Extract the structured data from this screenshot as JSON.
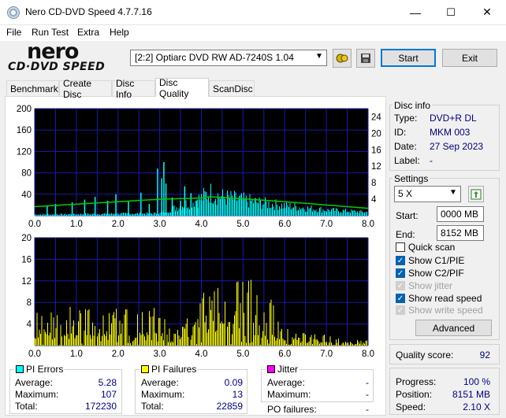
{
  "window": {
    "title": "Nero CD-DVD Speed 4.7.7.16",
    "minimize": "—",
    "maximize": "☐",
    "close": "✕"
  },
  "menu": [
    "File",
    "Run Test",
    "Extra",
    "Help"
  ],
  "logo": {
    "main": "nero",
    "sub": "CD·DVD SPEED"
  },
  "toolbar": {
    "drive": "[2:2]  Optiarc DVD RW AD-7240S 1.04",
    "start_label": "Start",
    "exit_label": "Exit"
  },
  "tabs": [
    "Benchmark",
    "Create Disc",
    "Disc Info",
    "Disc Quality",
    "ScanDisc"
  ],
  "active_tab": "Disc Quality",
  "disc_info": {
    "title": "Disc info",
    "type_label": "Type:",
    "type": "DVD+R DL",
    "id_label": "ID:",
    "id": "MKM 003",
    "date_label": "Date:",
    "date": "27 Sep 2023",
    "label_label": "Label:",
    "label": "-"
  },
  "settings": {
    "title": "Settings",
    "speed": "5 X",
    "start_label": "Start:",
    "start": "0000 MB",
    "end_label": "End:",
    "end": "8152 MB",
    "quick_scan": "Quick scan",
    "show_c1": "Show C1/PIE",
    "show_c2": "Show C2/PIF",
    "show_jitter": "Show jitter",
    "show_read": "Show read speed",
    "show_write": "Show write speed",
    "advanced": "Advanced"
  },
  "quality": {
    "label": "Quality score:",
    "value": "92"
  },
  "progress": {
    "progress_label": "Progress:",
    "progress": "100 %",
    "position_label": "Position:",
    "position": "8151 MB",
    "speed_label": "Speed:",
    "speed": "2.10 X"
  },
  "pi_errors": {
    "title": "PI Errors",
    "color": "#00ffff",
    "avg_label": "Average:",
    "avg": "5.28",
    "max_label": "Maximum:",
    "max": "107",
    "total_label": "Total:",
    "total": "172230"
  },
  "pi_failures": {
    "title": "PI Failures",
    "color": "#ffff00",
    "avg_label": "Average:",
    "avg": "0.09",
    "max_label": "Maximum:",
    "max": "13",
    "total_label": "Total:",
    "total": "22859"
  },
  "jitter": {
    "title": "Jitter",
    "color": "#ff00ff",
    "avg_label": "Average:",
    "avg": "-",
    "max_label": "Maximum:",
    "max": "-",
    "po_label": "PO failures:",
    "po": "-"
  },
  "chart_data": [
    {
      "type": "bar",
      "name": "PI Errors",
      "x_ticks": [
        "0.0",
        "1.0",
        "2.0",
        "3.0",
        "4.0",
        "5.0",
        "6.0",
        "7.0",
        "8.0"
      ],
      "y_ticks_left": [
        "200",
        "160",
        "120",
        "80",
        "40"
      ],
      "y_ticks_right": [
        "24",
        "20",
        "16",
        "12",
        "8",
        "4"
      ],
      "xlim": [
        0,
        8
      ],
      "ylim": [
        0,
        200
      ],
      "y2lim": [
        0,
        26
      ],
      "series_color": "#00ffff",
      "spikes": [
        [
          0.3,
          18
        ],
        [
          0.5,
          22
        ],
        [
          0.9,
          25
        ],
        [
          1.2,
          30
        ],
        [
          1.45,
          35
        ],
        [
          1.75,
          28
        ],
        [
          1.95,
          40
        ],
        [
          2.25,
          27
        ],
        [
          2.55,
          43
        ],
        [
          2.75,
          22
        ],
        [
          2.95,
          88
        ],
        [
          3.05,
          70
        ],
        [
          3.1,
          100
        ],
        [
          3.15,
          60
        ],
        [
          3.3,
          34
        ],
        [
          3.5,
          28
        ],
        [
          3.6,
          55
        ],
        [
          3.75,
          42
        ],
        [
          3.9,
          30
        ]
      ],
      "baseline": [
        [
          0,
          3
        ],
        [
          1,
          4
        ],
        [
          2,
          5
        ],
        [
          3,
          6
        ],
        [
          4,
          45
        ],
        [
          4.2,
          60
        ],
        [
          4.5,
          48
        ],
        [
          5,
          40
        ],
        [
          5.5,
          32
        ],
        [
          6,
          26
        ],
        [
          6.5,
          20
        ],
        [
          7,
          15
        ],
        [
          7.5,
          12
        ],
        [
          8,
          9
        ]
      ],
      "read_speed": [
        [
          0,
          2.2
        ],
        [
          1,
          2.8
        ],
        [
          2,
          3.4
        ],
        [
          3,
          4.0
        ],
        [
          4,
          4.3
        ],
        [
          4.2,
          4.6
        ],
        [
          5,
          4.1
        ],
        [
          6,
          3.4
        ],
        [
          7,
          2.6
        ],
        [
          8,
          1.8
        ]
      ]
    },
    {
      "type": "bar",
      "name": "PI Failures",
      "x_ticks": [
        "0.0",
        "1.0",
        "2.0",
        "3.0",
        "4.0",
        "5.0",
        "6.0",
        "7.0",
        "8.0"
      ],
      "y_ticks_left": [
        "20",
        "16",
        "12",
        "8",
        "4"
      ],
      "xlim": [
        0,
        8
      ],
      "ylim": [
        0,
        20
      ],
      "series_color": "#ffff00",
      "profile": [
        [
          0,
          6
        ],
        [
          0.5,
          7
        ],
        [
          1,
          7
        ],
        [
          1.5,
          8
        ],
        [
          2,
          8
        ],
        [
          2.5,
          6
        ],
        [
          3,
          7
        ],
        [
          3.5,
          5
        ],
        [
          3.9,
          4
        ],
        [
          4.0,
          11
        ],
        [
          4.3,
          12
        ],
        [
          4.6,
          11
        ],
        [
          5.0,
          12
        ],
        [
          5.3,
          11
        ],
        [
          5.6,
          10
        ],
        [
          5.9,
          4
        ],
        [
          6.5,
          2
        ],
        [
          7,
          2
        ],
        [
          7.5,
          1
        ],
        [
          8,
          1
        ]
      ]
    }
  ]
}
